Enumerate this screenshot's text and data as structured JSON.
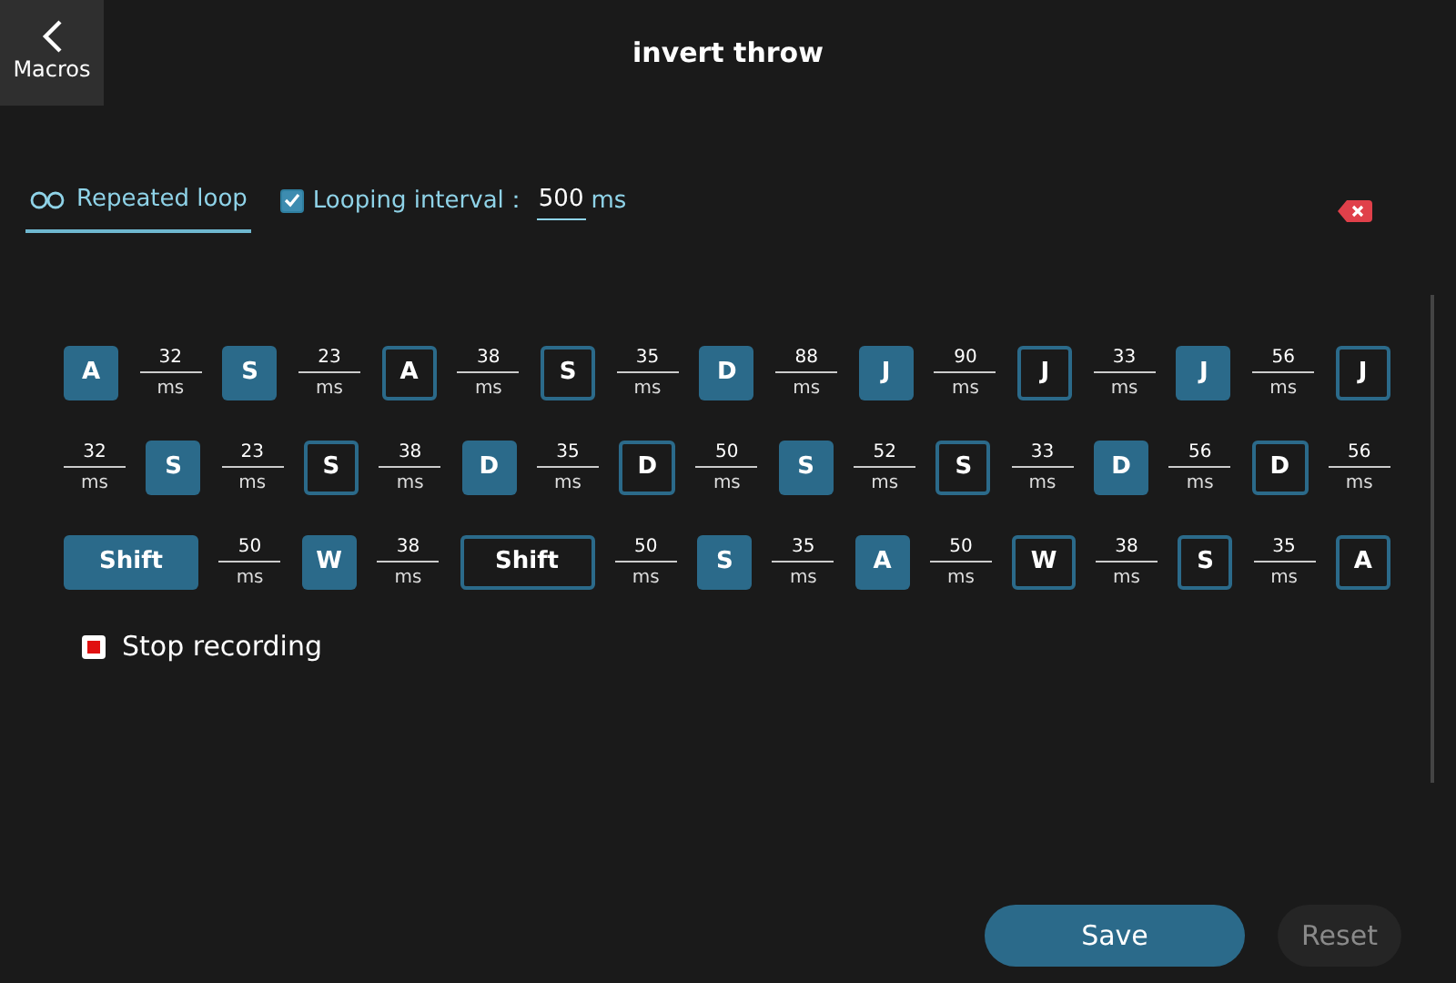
{
  "back_button": {
    "label": "Macros"
  },
  "title": "invert throw",
  "loop_tab": {
    "label": "Repeated loop",
    "selected": true
  },
  "interval": {
    "label": "Looping interval",
    "colon": "：",
    "checked": true,
    "value": "500",
    "unit": "ms"
  },
  "sequence": [
    [
      {
        "kind": "down",
        "key": "A"
      },
      {
        "kind": "delay",
        "value": "32",
        "unit": "ms"
      },
      {
        "kind": "down",
        "key": "S"
      },
      {
        "kind": "delay",
        "value": "23",
        "unit": "ms"
      },
      {
        "kind": "up",
        "key": "A"
      },
      {
        "kind": "delay",
        "value": "38",
        "unit": "ms"
      },
      {
        "kind": "up",
        "key": "S"
      },
      {
        "kind": "delay",
        "value": "35",
        "unit": "ms"
      },
      {
        "kind": "down",
        "key": "D"
      },
      {
        "kind": "delay",
        "value": "88",
        "unit": "ms"
      },
      {
        "kind": "down",
        "key": "J"
      },
      {
        "kind": "delay",
        "value": "90",
        "unit": "ms"
      },
      {
        "kind": "up",
        "key": "J"
      },
      {
        "kind": "delay",
        "value": "33",
        "unit": "ms"
      },
      {
        "kind": "down",
        "key": "J"
      },
      {
        "kind": "delay",
        "value": "56",
        "unit": "ms"
      },
      {
        "kind": "up",
        "key": "J"
      }
    ],
    [
      {
        "kind": "delay",
        "value": "32",
        "unit": "ms"
      },
      {
        "kind": "down",
        "key": "S"
      },
      {
        "kind": "delay",
        "value": "23",
        "unit": "ms"
      },
      {
        "kind": "up",
        "key": "S"
      },
      {
        "kind": "delay",
        "value": "38",
        "unit": "ms"
      },
      {
        "kind": "down",
        "key": "D"
      },
      {
        "kind": "delay",
        "value": "35",
        "unit": "ms"
      },
      {
        "kind": "up",
        "key": "D"
      },
      {
        "kind": "delay",
        "value": "50",
        "unit": "ms"
      },
      {
        "kind": "down",
        "key": "S"
      },
      {
        "kind": "delay",
        "value": "52",
        "unit": "ms"
      },
      {
        "kind": "up",
        "key": "S"
      },
      {
        "kind": "delay",
        "value": "33",
        "unit": "ms"
      },
      {
        "kind": "down",
        "key": "D"
      },
      {
        "kind": "delay",
        "value": "56",
        "unit": "ms"
      },
      {
        "kind": "up",
        "key": "D"
      },
      {
        "kind": "delay",
        "value": "56",
        "unit": "ms"
      }
    ],
    [
      {
        "kind": "down",
        "key": "Shift"
      },
      {
        "kind": "delay",
        "value": "50",
        "unit": "ms"
      },
      {
        "kind": "down",
        "key": "W"
      },
      {
        "kind": "delay",
        "value": "38",
        "unit": "ms"
      },
      {
        "kind": "up",
        "key": "Shift"
      },
      {
        "kind": "delay",
        "value": "50",
        "unit": "ms"
      },
      {
        "kind": "down",
        "key": "S"
      },
      {
        "kind": "delay",
        "value": "35",
        "unit": "ms"
      },
      {
        "kind": "down",
        "key": "A"
      },
      {
        "kind": "delay",
        "value": "50",
        "unit": "ms"
      },
      {
        "kind": "up",
        "key": "W"
      },
      {
        "kind": "delay",
        "value": "38",
        "unit": "ms"
      },
      {
        "kind": "up",
        "key": "S"
      },
      {
        "kind": "delay",
        "value": "35",
        "unit": "ms"
      },
      {
        "kind": "up",
        "key": "A"
      }
    ]
  ],
  "recording": {
    "label": "Stop recording",
    "recording": true
  },
  "buttons": [
    {
      "label": "Save",
      "disabled": false
    },
    {
      "label": "Reset",
      "disabled": true
    }
  ]
}
